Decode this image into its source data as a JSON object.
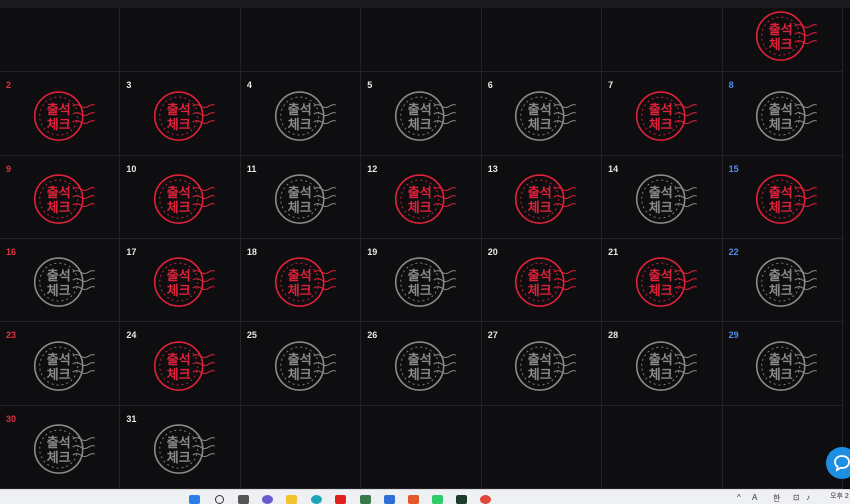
{
  "stamp": {
    "text_top": "출석",
    "text_bottom": "체크",
    "checked_color": "#e0213a",
    "unchecked_color": "#8a8a8a"
  },
  "colors": {
    "sunday": "#e0313f",
    "saturday": "#4f8ee6",
    "weekday": "#e8e8e8"
  },
  "weeks": [
    [
      {
        "day": "",
        "type": "blank",
        "stamp": "none"
      },
      {
        "day": "",
        "type": "blank",
        "stamp": "none"
      },
      {
        "day": "",
        "type": "blank",
        "stamp": "none"
      },
      {
        "day": "",
        "type": "blank",
        "stamp": "none"
      },
      {
        "day": "",
        "type": "blank",
        "stamp": "none"
      },
      {
        "day": "",
        "type": "blank",
        "stamp": "none"
      },
      {
        "day": "",
        "type": "sat",
        "stamp": "checked"
      }
    ],
    [
      {
        "day": "2",
        "type": "sun",
        "stamp": "checked"
      },
      {
        "day": "3",
        "type": "weekday",
        "stamp": "checked"
      },
      {
        "day": "4",
        "type": "weekday",
        "stamp": "unchecked"
      },
      {
        "day": "5",
        "type": "weekday",
        "stamp": "unchecked"
      },
      {
        "day": "6",
        "type": "weekday",
        "stamp": "unchecked"
      },
      {
        "day": "7",
        "type": "weekday",
        "stamp": "checked"
      },
      {
        "day": "8",
        "type": "sat",
        "stamp": "unchecked"
      }
    ],
    [
      {
        "day": "9",
        "type": "sun",
        "stamp": "checked"
      },
      {
        "day": "10",
        "type": "weekday",
        "stamp": "checked"
      },
      {
        "day": "11",
        "type": "weekday",
        "stamp": "unchecked"
      },
      {
        "day": "12",
        "type": "weekday",
        "stamp": "checked"
      },
      {
        "day": "13",
        "type": "weekday",
        "stamp": "checked"
      },
      {
        "day": "14",
        "type": "weekday",
        "stamp": "unchecked"
      },
      {
        "day": "15",
        "type": "sat",
        "stamp": "checked"
      }
    ],
    [
      {
        "day": "16",
        "type": "sun",
        "stamp": "unchecked"
      },
      {
        "day": "17",
        "type": "weekday",
        "stamp": "checked"
      },
      {
        "day": "18",
        "type": "weekday",
        "stamp": "checked"
      },
      {
        "day": "19",
        "type": "weekday",
        "stamp": "unchecked"
      },
      {
        "day": "20",
        "type": "weekday",
        "stamp": "checked"
      },
      {
        "day": "21",
        "type": "weekday",
        "stamp": "checked"
      },
      {
        "day": "22",
        "type": "sat",
        "stamp": "unchecked"
      }
    ],
    [
      {
        "day": "23",
        "type": "sun",
        "stamp": "unchecked"
      },
      {
        "day": "24",
        "type": "weekday",
        "stamp": "checked"
      },
      {
        "day": "25",
        "type": "weekday",
        "stamp": "unchecked"
      },
      {
        "day": "26",
        "type": "weekday",
        "stamp": "unchecked"
      },
      {
        "day": "27",
        "type": "weekday",
        "stamp": "unchecked"
      },
      {
        "day": "28",
        "type": "weekday",
        "stamp": "unchecked"
      },
      {
        "day": "29",
        "type": "sat",
        "stamp": "unchecked"
      }
    ],
    [
      {
        "day": "30",
        "type": "sun",
        "stamp": "unchecked"
      },
      {
        "day": "31",
        "type": "weekday",
        "stamp": "unchecked"
      },
      {
        "day": "",
        "type": "blank",
        "stamp": "none"
      },
      {
        "day": "",
        "type": "blank",
        "stamp": "none"
      },
      {
        "day": "",
        "type": "blank",
        "stamp": "none"
      },
      {
        "day": "",
        "type": "blank",
        "stamp": "none"
      },
      {
        "day": "",
        "type": "blank",
        "stamp": "none"
      }
    ]
  ],
  "taskbar": {
    "icons": [
      "windows-start-icon",
      "search-icon",
      "task-view-icon",
      "chat-app-icon",
      "file-explorer-icon",
      "edge-browser-icon",
      "youtube-icon",
      "app-icon",
      "store-icon",
      "office-icon",
      "messenger-icon",
      "terminal-icon",
      "chrome-icon"
    ],
    "tray_lang": "한",
    "tray_time": "오후 2"
  },
  "chat_button_icon": "chat-bubble-icon"
}
